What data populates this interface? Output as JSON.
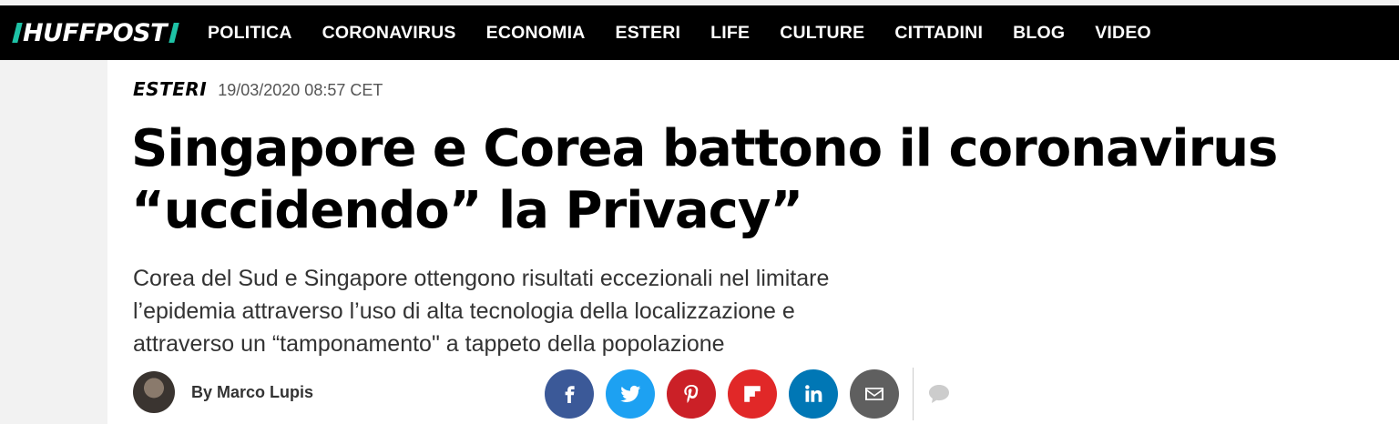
{
  "header": {
    "logo_text": "HUFFPOST",
    "nav": [
      "POLITICA",
      "CORONAVIRUS",
      "ECONOMIA",
      "ESTERI",
      "LIFE",
      "CULTURE",
      "CITTADINI",
      "BLOG",
      "VIDEO"
    ]
  },
  "article": {
    "section": "ESTERI",
    "timestamp": "19/03/2020 08:57 CET",
    "headline_line1": "Singapore e Corea battono il coronavirus",
    "headline_line2": "“uccidendo” la Privacy”",
    "dek_line1": "Corea del Sud e Singapore ottengono risultati eccezionali nel limitare",
    "dek_line2": "l’epidemia attraverso l’uso di alta tecnologia della localizzazione e",
    "dek_line3": "attraverso un “tamponamento\" a tappeto della popolazione",
    "byline": "By Marco Lupis"
  },
  "share": [
    {
      "name": "facebook-icon",
      "color": "#3b5998"
    },
    {
      "name": "twitter-icon",
      "color": "#1da1f2"
    },
    {
      "name": "pinterest-icon",
      "color": "#cb2027"
    },
    {
      "name": "flipboard-icon",
      "color": "#e12828"
    },
    {
      "name": "linkedin-icon",
      "color": "#0077b5"
    },
    {
      "name": "email-icon",
      "color": "#5f5f5f"
    }
  ],
  "colors": {
    "brand_accent": "#1ec2a6",
    "comment_icon": "#cccccc"
  }
}
